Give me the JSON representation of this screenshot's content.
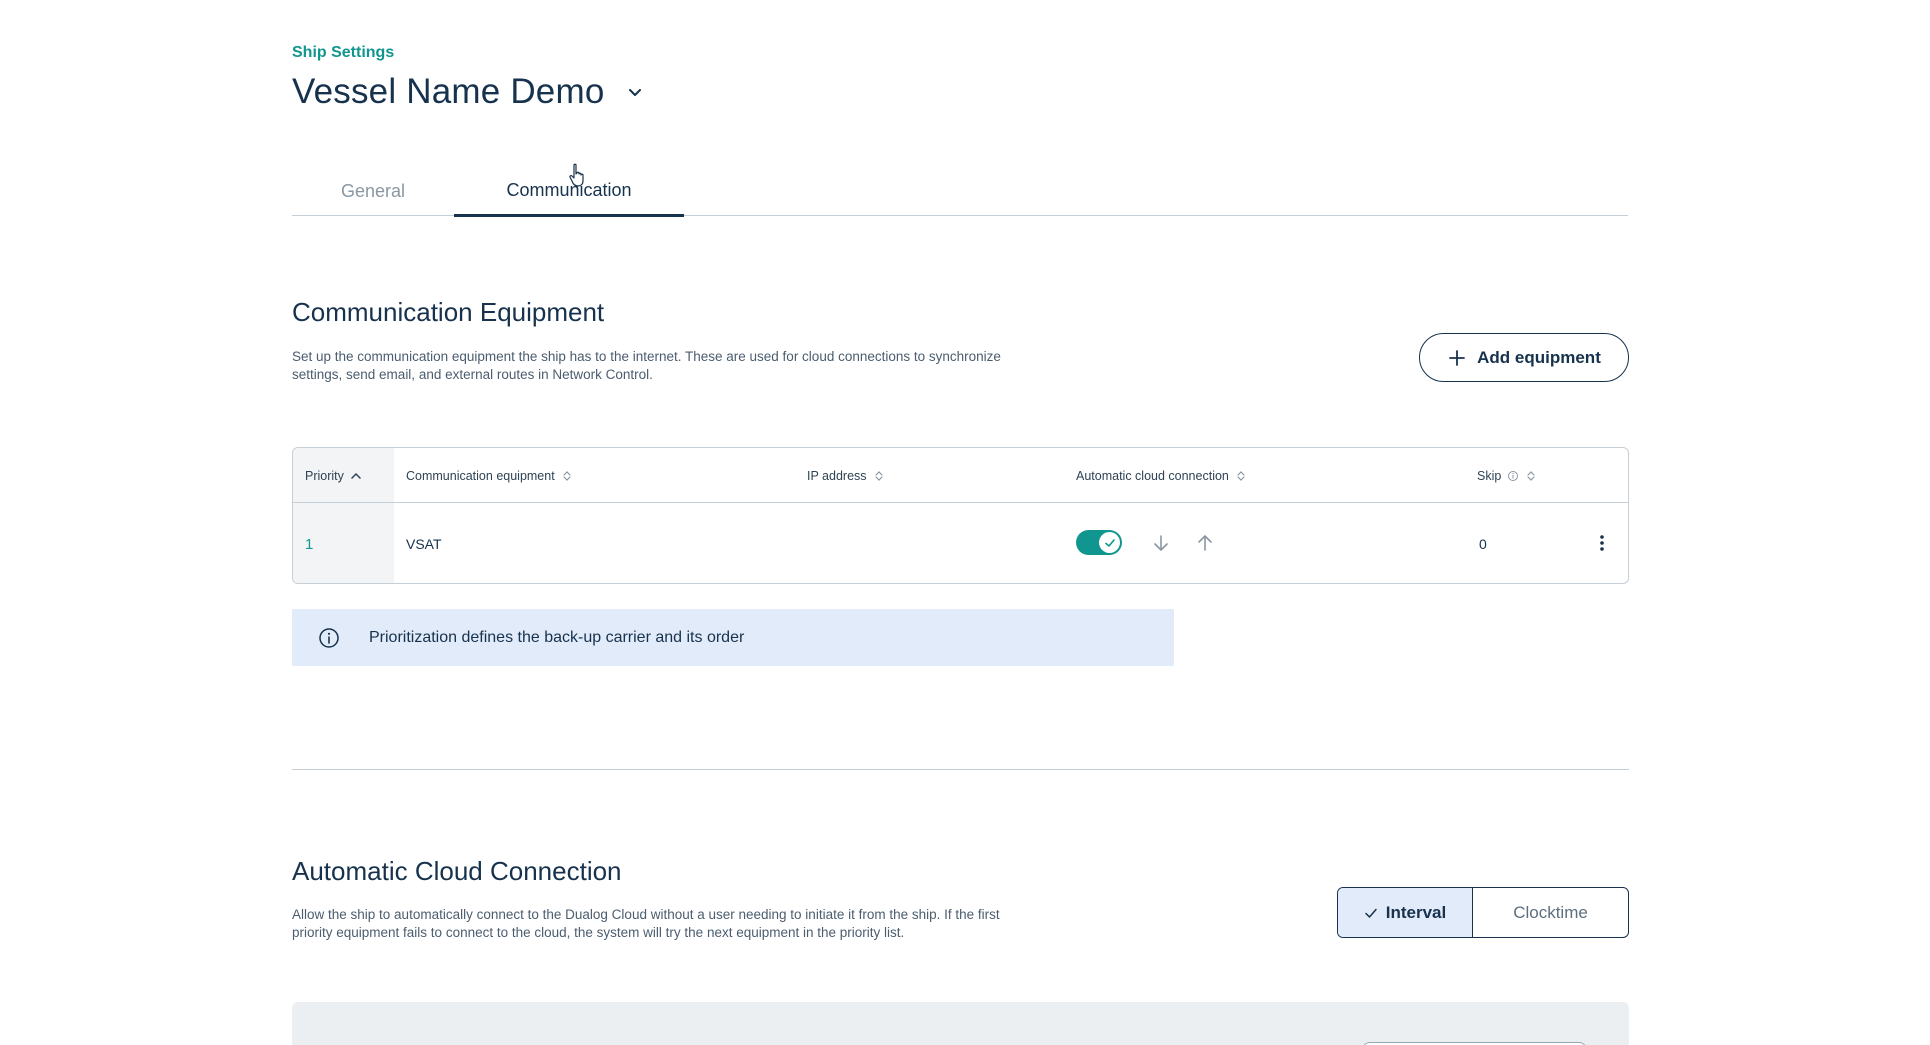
{
  "header": {
    "breadcrumb": "Ship Settings",
    "vessel_name": "Vessel Name Demo"
  },
  "tabs": [
    {
      "label": "General",
      "active": false
    },
    {
      "label": "Communication",
      "active": true
    }
  ],
  "communication_equipment": {
    "title": "Communication Equipment",
    "description": "Set up the communication equipment the ship has to the internet. These are used for cloud connections to synchronize settings, send email, and external routes in Network Control.",
    "add_button_label": "Add equipment",
    "table": {
      "columns": [
        "Priority",
        "Communication equipment",
        "IP address",
        "Automatic cloud connection",
        "Skip"
      ],
      "rows": [
        {
          "priority": "1",
          "equipment": "VSAT",
          "ip_address": "",
          "auto_cloud_connection": true,
          "skip": "0"
        }
      ]
    },
    "info_message": "Prioritization defines the back-up carrier and its order"
  },
  "automatic_cloud_connection": {
    "title": "Automatic Cloud Connection",
    "description": "Allow the ship to automatically connect to the Dualog Cloud without a user needing to initiate it from the ship. If the first priority equipment fails to connect to the cloud, the system will try the next equipment in the priority list.",
    "modes": [
      {
        "label": "Interval",
        "selected": true
      },
      {
        "label": "Clocktime",
        "selected": false
      }
    ]
  },
  "colors": {
    "primary": "#17324d",
    "accent_teal": "#11968f",
    "info_bg": "#e2ebf9"
  }
}
